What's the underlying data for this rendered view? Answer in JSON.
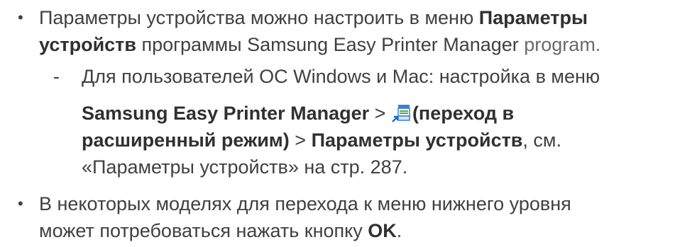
{
  "item1": {
    "bullet": "•",
    "l1_a": "Параметры устройства можно настроить в меню ",
    "l1_b": "Параметры",
    "l2_a": "устройств",
    "l2_b": " программы Samsung Easy Printer Manager",
    "l2_c": " program.",
    "sub": {
      "dash": "-",
      "l3": "Для пользователей ОС Windows и Mac: настройка в меню",
      "l4_a": "Samsung Easy Printer Manager",
      "l4_b": " > ",
      "l4_c": "(переход в",
      "l5_a": "расширенный режим)",
      "l5_b": " > ",
      "l5_c": "Параметры устройств",
      "l5_d": ", см.",
      "l6": "«Параметры устройств» на стр. 287."
    }
  },
  "item2": {
    "bullet": "•",
    "l7": "В некоторых моделях для перехода к меню нижнего уровня",
    "l8_a": "может потребоваться нажать кнопку ",
    "l8_b": "OK",
    "l8_c": "."
  },
  "icons": {
    "advanced_mode": "advanced-mode-icon"
  }
}
